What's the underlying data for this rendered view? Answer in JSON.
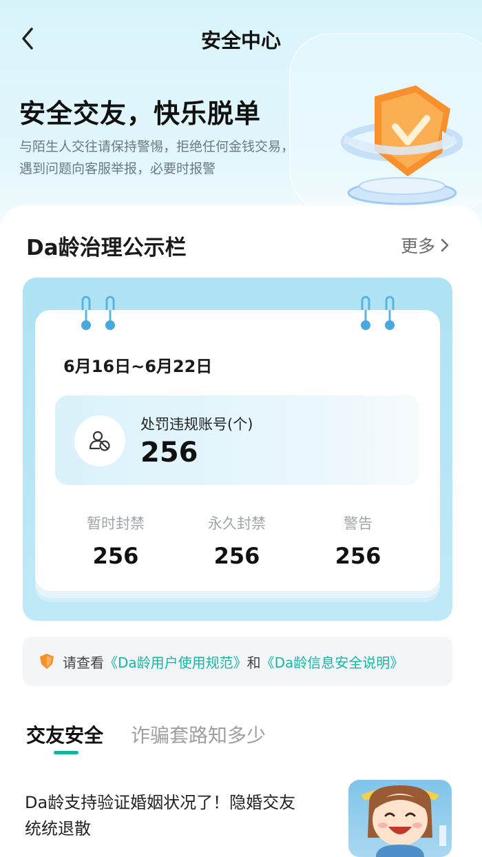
{
  "header": {
    "title": "安全中心"
  },
  "hero": {
    "title": "安全交友，快乐脱单",
    "desc_line1": "与陌生人交往请保持警惕，拒绝任何金钱交易，",
    "desc_line2": "遇到问题向客服举报，必要时报警"
  },
  "board": {
    "title": "Da龄治理公示栏",
    "more_label": "更多",
    "date_range": "6月16日~6月22日",
    "penalty": {
      "label": "处罚违规账号(个)",
      "value": "256"
    },
    "stats": [
      {
        "label": "暂时封禁",
        "value": "256"
      },
      {
        "label": "永久封禁",
        "value": "256"
      },
      {
        "label": "警告",
        "value": "256"
      }
    ]
  },
  "notice": {
    "prefix": "请查看",
    "link1": "《Da龄用户使用规范》",
    "conj": "和",
    "link2": "《Da龄信息安全说明》"
  },
  "tabs": [
    {
      "label": "交友安全",
      "active": true
    },
    {
      "label": "诈骗套路知多少",
      "active": false
    }
  ],
  "article": {
    "title_line1": "Da龄支持验证婚姻状况了！隐婚交友",
    "title_line2": "统统退散"
  },
  "colors": {
    "accent": "#14b3a6",
    "link": "#18b5a7",
    "shield": "#f7902d"
  }
}
